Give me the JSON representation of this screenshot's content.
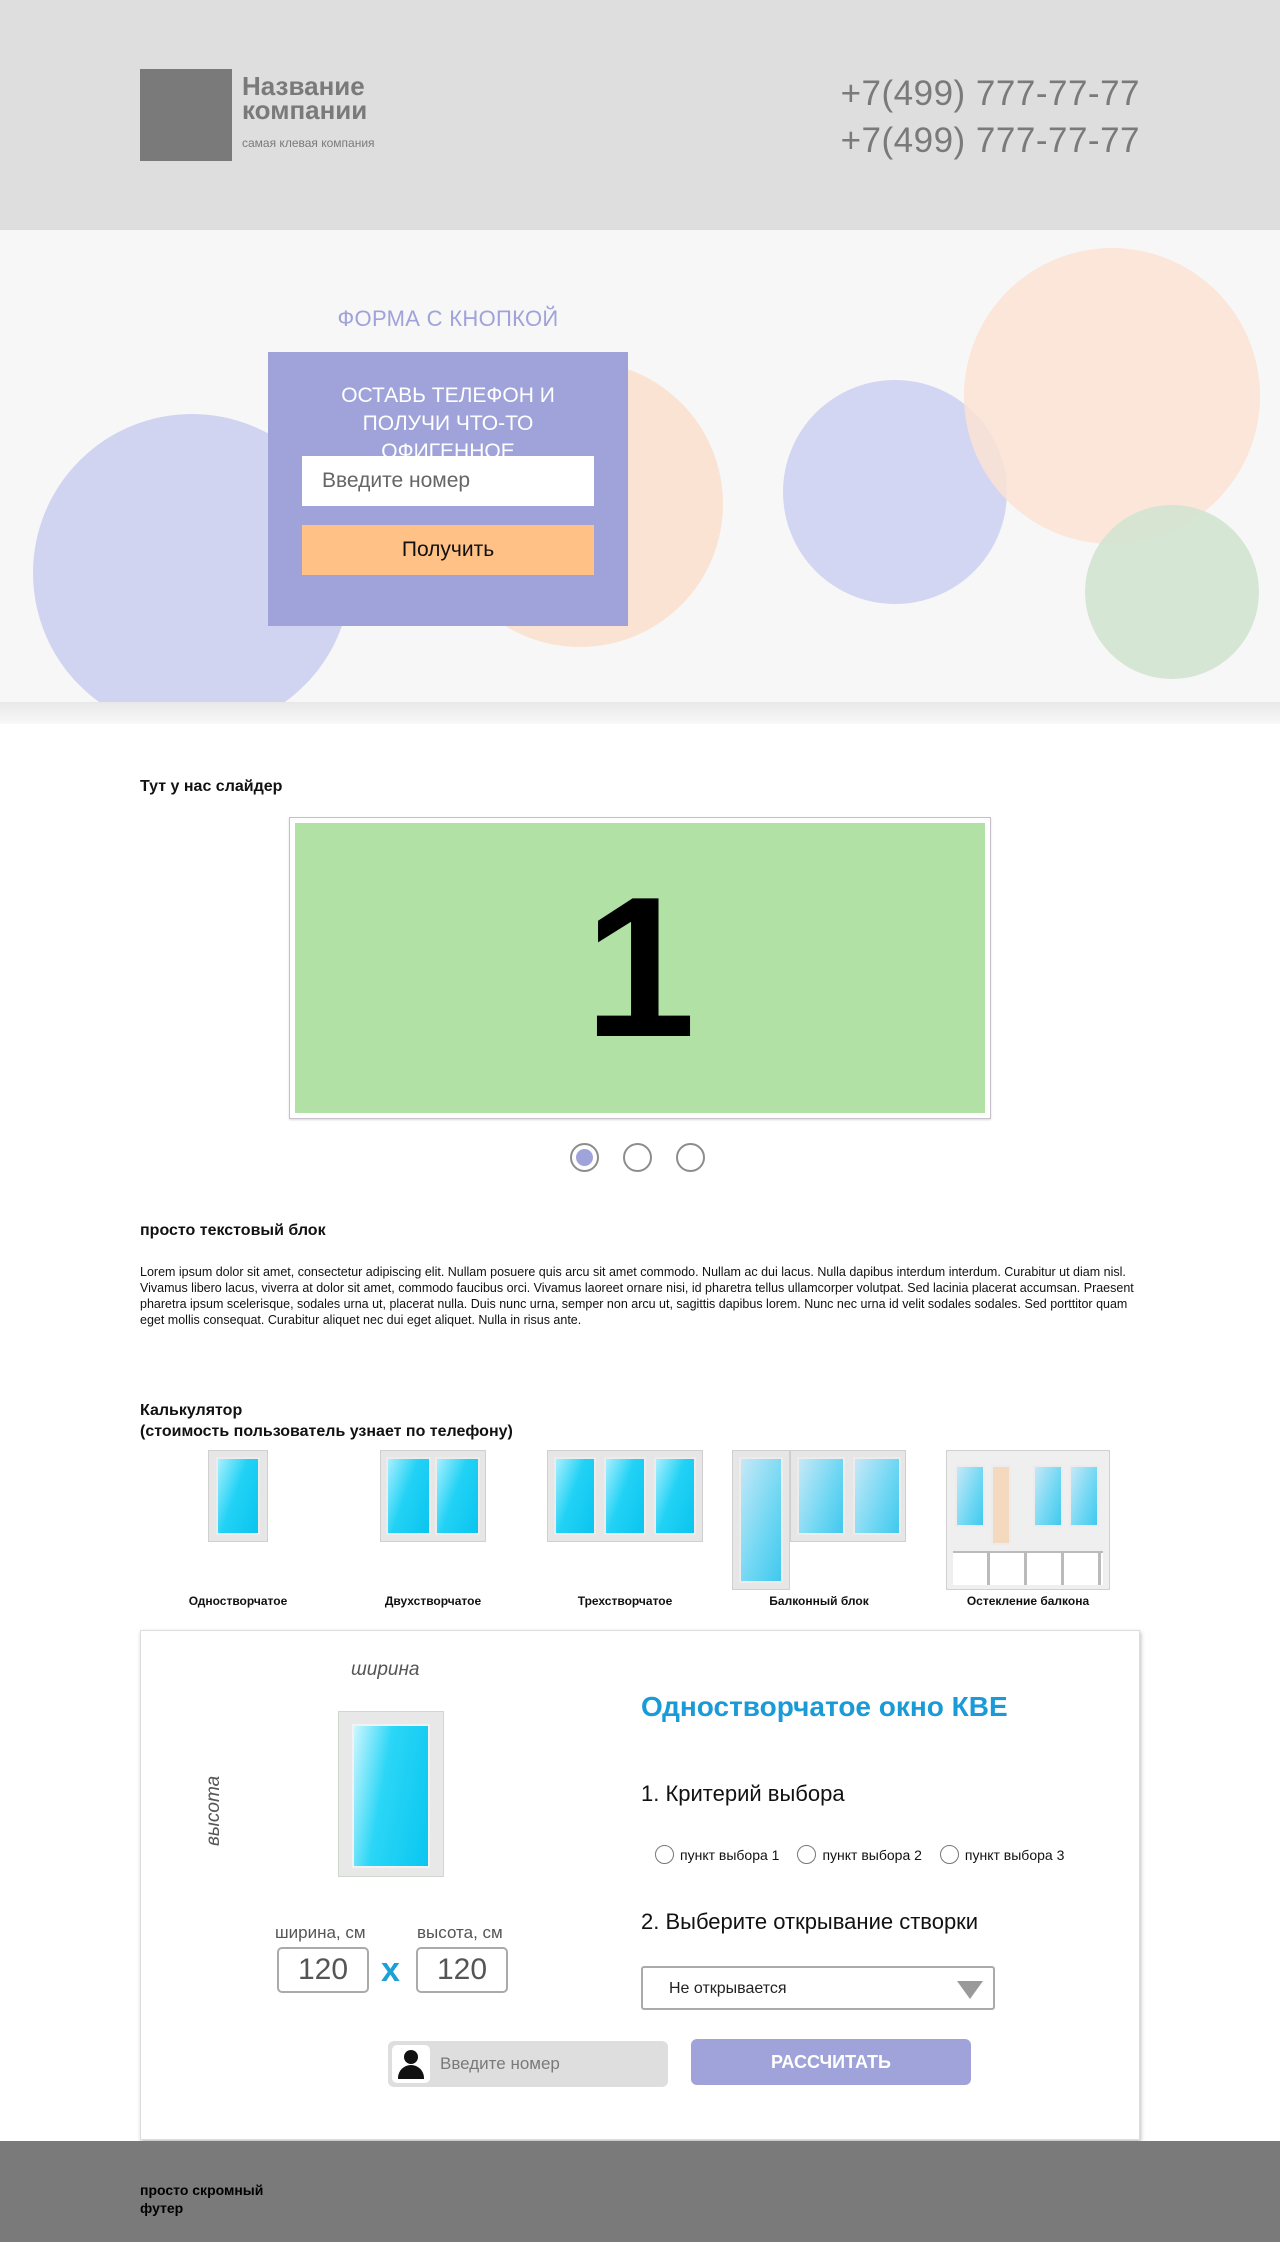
{
  "header": {
    "company_name": "Название компании",
    "tagline": "самая клевая компания",
    "phones": [
      "+7(499) 777-77-77",
      "+7(499) 777-77-77"
    ]
  },
  "hero": {
    "form_heading": "ФОРМА С КНОПКОЙ",
    "form_title": "ОСТАВЬ ТЕЛЕФОН И ПОЛУЧИ ЧТО-ТО ОФИГЕННОЕ",
    "input_placeholder": "Введите номер",
    "button_label": "Получить"
  },
  "slider": {
    "title": "Тут у нас слайдер",
    "current_slide": "1",
    "slide_color": "#b1e1a4",
    "dots_total": 3,
    "active_dot": 1
  },
  "text_block": {
    "title": "просто текстовый блок",
    "body": "Lorem ipsum dolor sit amet, consectetur adipiscing elit. Nullam posuere quis arcu sit amet commodo. Nullam ac dui lacus. Nulla dapibus interdum interdum. Curabitur ut diam nisl. Vivamus libero lacus, viverra at dolor sit amet, commodo faucibus orci. Vivamus laoreet ornare nisi, id pharetra tellus ullamcorper volutpat. Sed lacinia placerat accumsan. Praesent pharetra ipsum scelerisque, sodales urna ut, placerat nulla. Duis nunc urna, semper non arcu ut, sagittis dapibus lorem. Nunc nec urna id velit sodales sodales. Sed porttitor quam eget mollis consequat. Curabitur aliquet nec dui eget aliquet. Nulla in risus ante."
  },
  "calculator": {
    "title_line1": "Калькулятор",
    "title_line2": "(стоимость пользователь узнает по телефону)",
    "window_types": [
      {
        "label": "Одностворчатое"
      },
      {
        "label": "Двухстворчатое"
      },
      {
        "label": "Трехстворчатое"
      },
      {
        "label": "Балконный блок"
      },
      {
        "label": "Остекление балкона"
      }
    ],
    "width_caption": "ширина",
    "height_caption": "высота",
    "width_label": "ширина, см",
    "height_label": "высота, см",
    "width_value": "120",
    "height_value": "120",
    "times_sign": "x",
    "heading": "Одностворчатое окно КВЕ",
    "criterion_title": "1. Критерий выбора",
    "options": [
      "пункт выбора 1",
      "пункт выбора 2",
      "пункт выбора 3"
    ],
    "opening_title": "2. Выберите открывание створки",
    "opening_selected": "Не открывается",
    "phone_placeholder": "Введите номер",
    "submit_label": "РАССЧИТАТЬ",
    "accent_color": "#1a9ad6"
  },
  "footer": {
    "text": "просто скромный футер"
  },
  "colors": {
    "header_bg": "#dedede",
    "lavender": "#9fa3d9",
    "peach": "#ffc186",
    "footer_bg": "#7a7a7a"
  }
}
